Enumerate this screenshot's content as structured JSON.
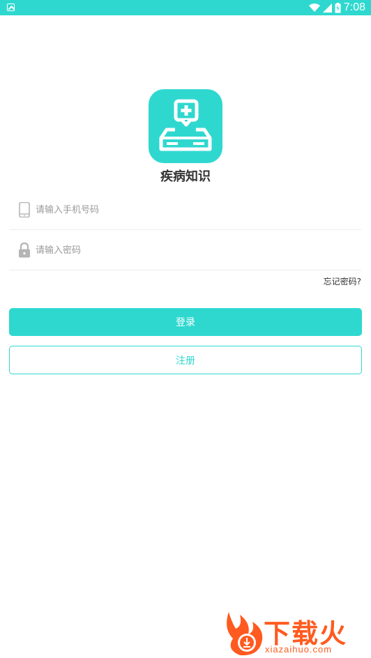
{
  "status_bar": {
    "time": "7:08"
  },
  "app": {
    "name": "疾病知识"
  },
  "form": {
    "phone_placeholder": "请输入手机号码",
    "password_placeholder": "请输入密码",
    "forgot_label": "忘记密码?",
    "login_label": "登录",
    "register_label": "注册"
  },
  "watermark": {
    "title": "下载火",
    "url": "xiazaihuo.com"
  },
  "colors": {
    "accent": "#2fd8cf",
    "watermark": "#ff5a1f"
  }
}
